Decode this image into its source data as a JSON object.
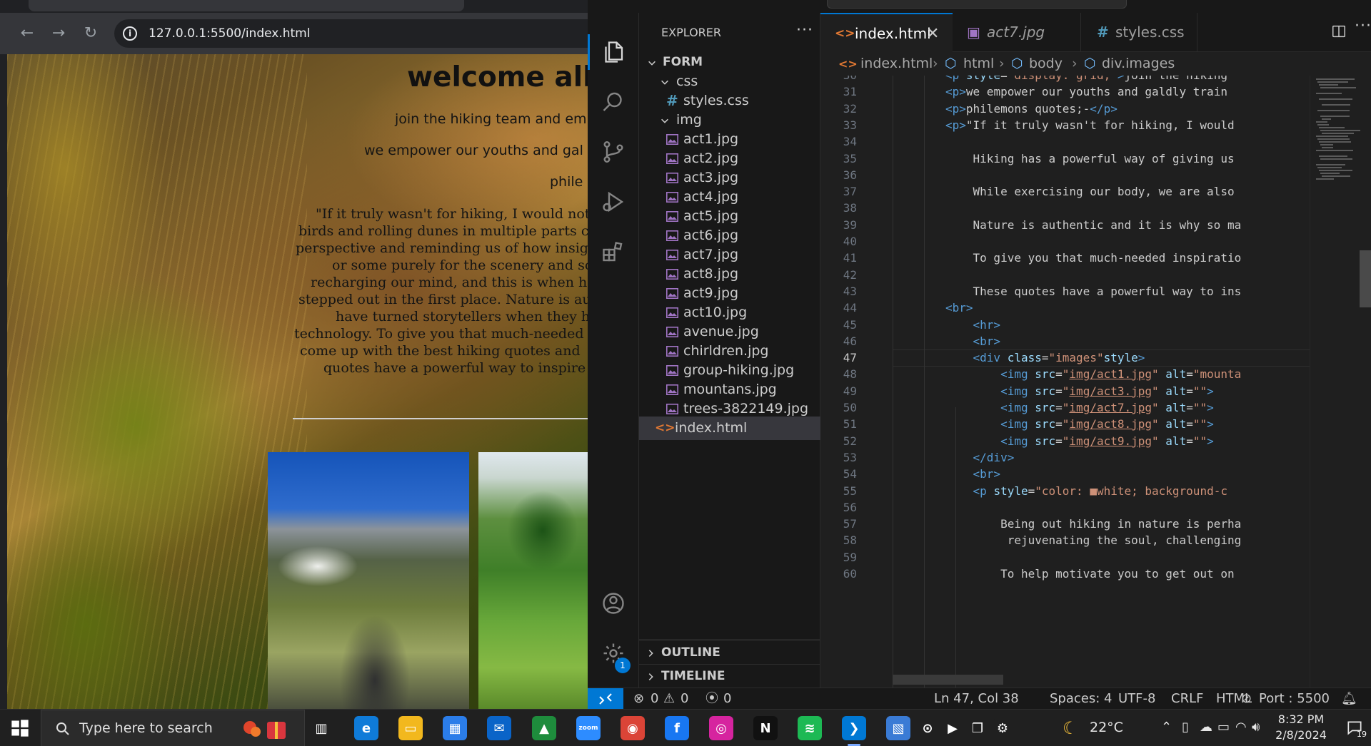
{
  "browser": {
    "url": "127.0.0.1:5500/index.html",
    "site": {
      "title": "welcome all",
      "line1": "join the hiking team and em",
      "line2": "we empower our youths and gal",
      "line3": "phile",
      "quote_lines": [
        "\"If it truly wasn't for hiking, I would not",
        "birds and rolling dunes in multiple parts c",
        "perspective and reminding us of how insig",
        "or some purely for the scenery and sc",
        "recharging our mind, and this is when h",
        "stepped out in the first place. Nature is au",
        "have turned storytellers when they h",
        "technology. To give you that much-needed",
        "come up with the best hiking quotes and",
        "quotes have a powerful way to inspire"
      ]
    }
  },
  "vscode": {
    "explorer": {
      "title": "EXPLORER",
      "more": "···",
      "root": "FORM",
      "css_folder": "css",
      "css_files": [
        "styles.css"
      ],
      "img_folder": "img",
      "img_files": [
        "act1.jpg",
        "act2.jpg",
        "act3.jpg",
        "act4.jpg",
        "act5.jpg",
        "act6.jpg",
        "act7.jpg",
        "act8.jpg",
        "act9.jpg",
        "act10.jpg",
        "avenue.jpg",
        "chirldren.jpg",
        "group-hiking.jpg",
        "mountans.jpg",
        "trees-3822149.jpg"
      ],
      "index_file": "index.html",
      "outline": "OUTLINE",
      "timeline": "TIMELINE"
    },
    "activity": {
      "settings_badge": "1"
    },
    "tabs": [
      {
        "label": "index.html",
        "icon": "<>"
      },
      {
        "label": "act7.jpg",
        "icon": "▣"
      },
      {
        "label": "styles.css",
        "icon": "#"
      }
    ],
    "tab_close": "✕",
    "more": "···",
    "breadcrumb": [
      "index.html",
      "html",
      "body",
      "div.images"
    ],
    "code": {
      "current_line": 47,
      "lines": [
        {
          "n": 30,
          "html": "<span class=\"tg\">&lt;p</span> <span class=\"at\">style</span>=<span class=\"st\">\"display: grid;\"</span><span class=\"tg\">&gt;</span>join the hiking "
        },
        {
          "n": 31,
          "html": "<span class=\"tg\">&lt;p&gt;</span>we empower our youths and galdly train "
        },
        {
          "n": 32,
          "html": "<span class=\"tg\">&lt;p&gt;</span>philemons quotes;-<span class=\"tg\">&lt;/p&gt;</span>"
        },
        {
          "n": 33,
          "html": "<span class=\"tg\">&lt;p&gt;</span>\"If it truly wasn't for hiking, I would"
        },
        {
          "n": 34,
          "html": ""
        },
        {
          "n": 35,
          "html": "    Hiking has a powerful way of giving us"
        },
        {
          "n": 36,
          "html": ""
        },
        {
          "n": 37,
          "html": "    While exercising our body, we are also"
        },
        {
          "n": 38,
          "html": ""
        },
        {
          "n": 39,
          "html": "    Nature is authentic and it is why so ma"
        },
        {
          "n": 40,
          "html": ""
        },
        {
          "n": 41,
          "html": "    To give you that much-needed inspiratio"
        },
        {
          "n": 42,
          "html": ""
        },
        {
          "n": 43,
          "html": "    These quotes have a powerful way to ins"
        },
        {
          "n": 44,
          "html": "<span class=\"tg\">&lt;br&gt;</span>"
        },
        {
          "n": 45,
          "html": "    <span class=\"tg\">&lt;hr&gt;</span>"
        },
        {
          "n": 46,
          "html": "    <span class=\"tg\">&lt;br&gt;</span>"
        },
        {
          "n": 47,
          "html": "    <span class=\"tg\">&lt;div</span> <span class=\"at\">class</span>=<span class=\"st\">\"images\"</span><span class=\"at\">style</span><span class=\"tg\">&gt;</span>"
        },
        {
          "n": 48,
          "html": "        <span class=\"tg\">&lt;img</span> <span class=\"at\">src</span>=<span class=\"st\">\"<span class=\"ul\">img/act1.jpg</span>\"</span> <span class=\"at\">alt</span>=<span class=\"st\">\"mounta</span>"
        },
        {
          "n": 49,
          "html": "        <span class=\"tg\">&lt;img</span> <span class=\"at\">src</span>=<span class=\"st\">\"<span class=\"ul\">img/act3.jpg</span>\"</span> <span class=\"at\">alt</span>=<span class=\"st\">\"\"</span><span class=\"tg\">&gt;</span>"
        },
        {
          "n": 50,
          "html": "        <span class=\"tg\">&lt;img</span> <span class=\"at\">src</span>=<span class=\"st\">\"<span class=\"ul\">img/act7.jpg</span>\"</span> <span class=\"at\">alt</span>=<span class=\"st\">\"\"</span><span class=\"tg\">&gt;</span>"
        },
        {
          "n": 51,
          "html": "        <span class=\"tg\">&lt;img</span> <span class=\"at\">src</span>=<span class=\"st\">\"<span class=\"ul\">img/act8.jpg</span>\"</span> <span class=\"at\">alt</span>=<span class=\"st\">\"\"</span><span class=\"tg\">&gt;</span>"
        },
        {
          "n": 52,
          "html": "        <span class=\"tg\">&lt;img</span> <span class=\"at\">src</span>=<span class=\"st\">\"<span class=\"ul\">img/act9.jpg</span>\"</span> <span class=\"at\">alt</span>=<span class=\"st\">\"\"</span><span class=\"tg\">&gt;</span>"
        },
        {
          "n": 53,
          "html": "    <span class=\"tg\">&lt;/div&gt;</span>"
        },
        {
          "n": 54,
          "html": "    <span class=\"tg\">&lt;br&gt;</span>"
        },
        {
          "n": 55,
          "html": "    <span class=\"tg\">&lt;p</span> <span class=\"at\">style</span>=<span class=\"st\">\"color: ■white; background-c</span>"
        },
        {
          "n": 56,
          "html": ""
        },
        {
          "n": 57,
          "html": "        Being out hiking in nature is perha"
        },
        {
          "n": 58,
          "html": "         rejuvenating the soul, challenging"
        },
        {
          "n": 59,
          "html": ""
        },
        {
          "n": 60,
          "html": "        To help motivate you to get out on"
        }
      ]
    },
    "status": {
      "errors": "0",
      "warnings": "0",
      "ports": "0",
      "position": "Ln 47, Col 38",
      "spaces": "Spaces: 4",
      "encoding": "UTF-8",
      "eol": "CRLF",
      "language": "HTML",
      "port": "Port : 5500"
    }
  },
  "taskbar": {
    "search_placeholder": "Type here to search",
    "weather_temp": "22°C",
    "time": "8:32 PM",
    "date": "2/8/2024",
    "notification_count": "19",
    "apps": [
      {
        "name": "task-view",
        "color": "#202020",
        "glyph": "▥"
      },
      {
        "name": "edge",
        "color": "#0f7bd8",
        "glyph": "e"
      },
      {
        "name": "file-explorer",
        "color": "#f2b81e",
        "glyph": "▭"
      },
      {
        "name": "microsoft-store",
        "color": "#2b7de9",
        "glyph": "▦"
      },
      {
        "name": "mail",
        "color": "#0a64c8",
        "glyph": "✉"
      },
      {
        "name": "stock-app",
        "color": "#1e8c3c",
        "glyph": "▲"
      },
      {
        "name": "zoom",
        "color": "#2d8cff",
        "glyph": "zoom"
      },
      {
        "name": "chrome",
        "color": "#db4437",
        "glyph": "◉"
      },
      {
        "name": "facebook",
        "color": "#1877f2",
        "glyph": "f"
      },
      {
        "name": "instagram",
        "color": "#d6249f",
        "glyph": "◎"
      },
      {
        "name": "netflix",
        "color": "#111111",
        "glyph": "N"
      },
      {
        "name": "spotify",
        "color": "#1db954",
        "glyph": "≋"
      },
      {
        "name": "vscode",
        "color": "#0078d4",
        "glyph": "❯"
      },
      {
        "name": "photos",
        "color": "#3a7bd5",
        "glyph": "▧"
      },
      {
        "name": "camera",
        "color": "#202020",
        "glyph": "⊙"
      },
      {
        "name": "video",
        "color": "#202020",
        "glyph": "▶"
      },
      {
        "name": "files",
        "color": "#202020",
        "glyph": "❐"
      },
      {
        "name": "settings",
        "color": "#202020",
        "glyph": "⚙"
      }
    ]
  }
}
